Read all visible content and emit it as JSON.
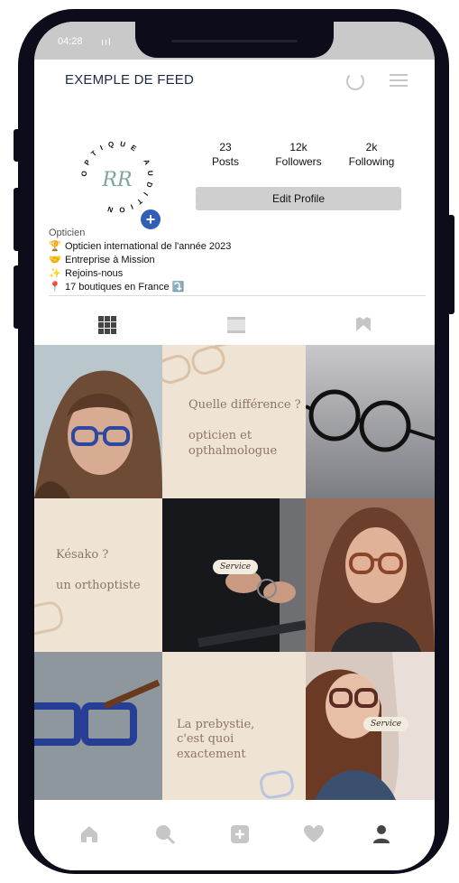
{
  "status_bar": {
    "time": "04:28",
    "signal": "ııl"
  },
  "header": {
    "title": "EXEMPLE DE FEED",
    "refresh_icon": "refresh-icon",
    "menu_icon": "menu-icon"
  },
  "profile": {
    "avatar_text": "OPTIQUE AUDITION",
    "avatar_monogram": "RR",
    "add_icon": "+",
    "stats": [
      {
        "value": "23",
        "label": "Posts"
      },
      {
        "value": "12k",
        "label": "Followers"
      },
      {
        "value": "2k",
        "label": "Following"
      }
    ],
    "edit_label": "Edit Profile",
    "bio": {
      "category": "Opticien",
      "lines": [
        {
          "emoji": "🏆",
          "text": "Opticien international de l'année 2023"
        },
        {
          "emoji": "🤝",
          "text": "Entreprise à Mission"
        },
        {
          "emoji": "✨",
          "text": "Rejoins-nous"
        },
        {
          "emoji": "📍",
          "text": "17 boutiques en France ⤵️"
        }
      ]
    }
  },
  "tabs": [
    "grid-icon",
    "feed-icon",
    "tagged-icon"
  ],
  "posts": {
    "tile2": {
      "line1": "Quelle différence ?",
      "line2": "opticien et",
      "line3": "opthalmologue"
    },
    "tile4": {
      "line1": "Késako ?",
      "line2": "un orthoptiste"
    },
    "tile5": {
      "badge": "Service"
    },
    "tile8": {
      "line1": "La prebystie,",
      "line2": "c'est quoi exactement"
    },
    "tile9": {
      "badge": "Service"
    }
  },
  "bottom_nav": [
    "home-icon",
    "search-icon",
    "add-post-icon",
    "heart-icon",
    "profile-icon"
  ],
  "colors": {
    "beige": "#efe3d3",
    "text_brown": "#8c7566",
    "accent_blue": "#2f5fb6",
    "frame": "#0c0c1a"
  }
}
